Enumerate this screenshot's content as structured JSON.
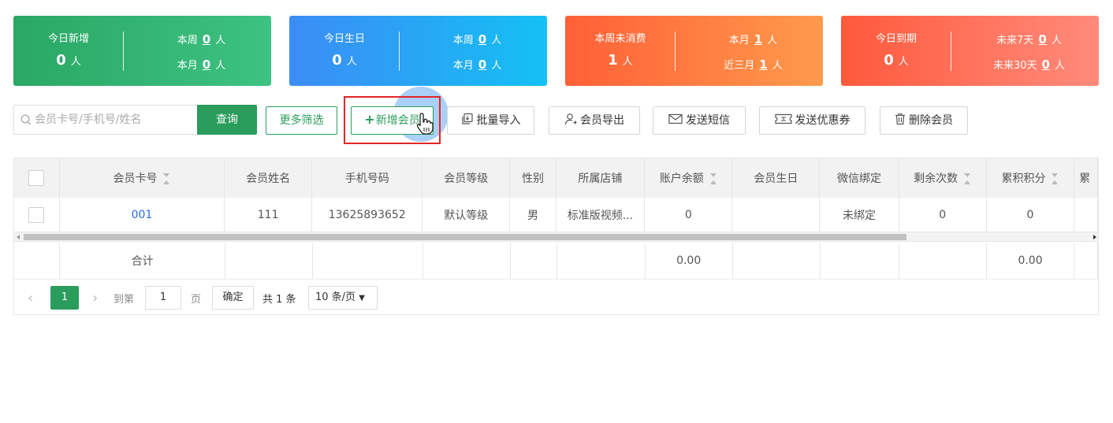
{
  "stats": [
    {
      "title": "今日新增",
      "value": "0",
      "unit": "人",
      "rows": [
        {
          "label": "本周",
          "value": "0",
          "unit": "人"
        },
        {
          "label": "本月",
          "value": "0",
          "unit": "人"
        }
      ]
    },
    {
      "title": "今日生日",
      "value": "0",
      "unit": "人",
      "rows": [
        {
          "label": "本周",
          "value": "0",
          "unit": "人"
        },
        {
          "label": "本月",
          "value": "0",
          "unit": "人"
        }
      ]
    },
    {
      "title": "本周未消费",
      "value": "1",
      "unit": "人",
      "rows": [
        {
          "label": "本月",
          "value": "1",
          "unit": "人"
        },
        {
          "label": "近三月",
          "value": "1",
          "unit": "人"
        }
      ]
    },
    {
      "title": "今日到期",
      "value": "0",
      "unit": "人",
      "rows": [
        {
          "label": "未来7天",
          "value": "0",
          "unit": "人"
        },
        {
          "label": "未来30天",
          "value": "0",
          "unit": "人"
        }
      ]
    }
  ],
  "toolbar": {
    "search_placeholder": "会员卡号/手机号/姓名",
    "query_label": "查询",
    "more_filter_label": "更多筛选",
    "add_member_label": "新增会员",
    "batch_import_label": "批量导入",
    "export_label": "会员导出",
    "send_sms_label": "发送短信",
    "send_coupon_label": "发送优惠券",
    "delete_label": "删除会员"
  },
  "table": {
    "columns": [
      "会员卡号",
      "会员姓名",
      "手机号码",
      "会员等级",
      "性别",
      "所属店铺",
      "账户余额",
      "会员生日",
      "微信绑定",
      "剩余次数",
      "累积积分",
      "累"
    ],
    "rows": [
      {
        "card": "001",
        "name": "111",
        "phone": "13625893652",
        "level": "默认等级",
        "gender": "男",
        "store": "标准版视频...",
        "balance": "0",
        "birthday": "",
        "wechat": "未绑定",
        "remaining": "0",
        "points": "0"
      }
    ],
    "footer": {
      "label": "合计",
      "balance_total": "0.00",
      "points_total": "0.00"
    }
  },
  "pagination": {
    "current_page": "1",
    "goto_label": "到第",
    "page_input": "1",
    "page_unit": "页",
    "confirm_label": "确定",
    "total_text": "共 1 条",
    "page_size": "10 条/页"
  },
  "colors": {
    "accent_green": "#2a9d5c",
    "highlight_red": "#e22626",
    "link_blue": "#2b6ad8"
  }
}
